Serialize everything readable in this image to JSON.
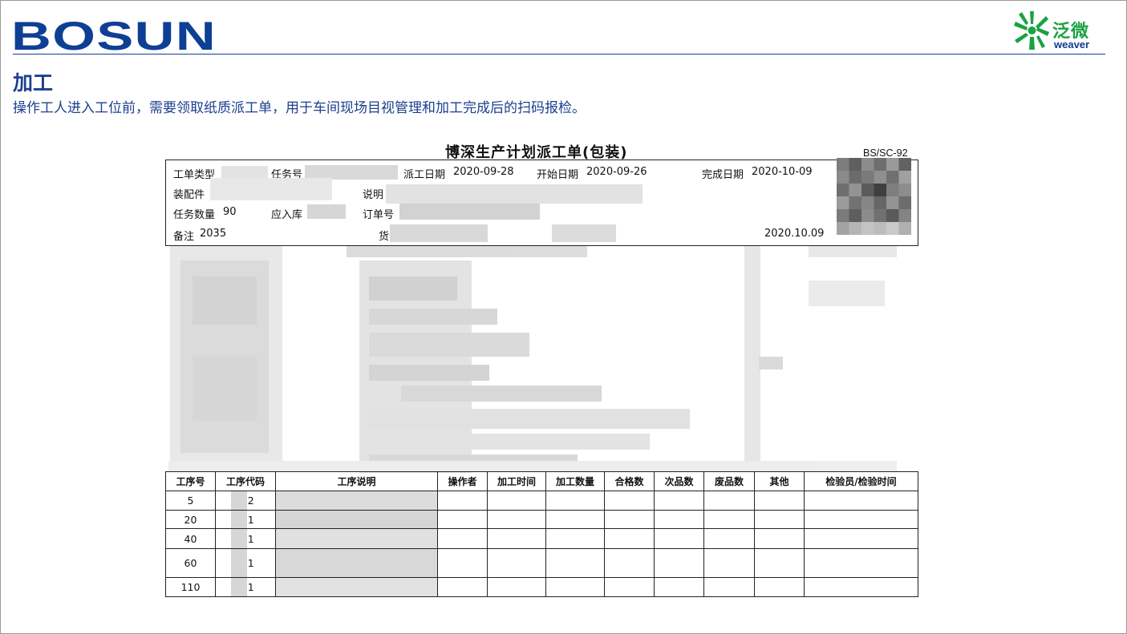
{
  "header": {
    "brand": "BOSUN",
    "partner_cn": "泛微",
    "partner_en": "weaver",
    "colors": {
      "brand_blue": "#0e3f94",
      "partner_green": "#1aa243",
      "text_blue": "#1c3f8f"
    }
  },
  "section": {
    "title": "加工",
    "description": "操作工人进入工位前，需要领取纸质派工单，用于车间现场目视管理和加工完成后的扫码报检。"
  },
  "document": {
    "title": "博深生产计划派工单(包装)",
    "code": "BS/SC-92",
    "fields": {
      "order_type_label": "工单类型",
      "task_no_label": "任务号",
      "dispatch_date_label": "派工日期",
      "dispatch_date": "2020-09-28",
      "start_date_label": "开始日期",
      "start_date": "2020-09-26",
      "finish_date_label": "完成日期",
      "finish_date": "2020-10-09",
      "part_label": "装配件",
      "note_label": "说明",
      "task_qty_label": "任务数量",
      "task_qty": "90",
      "inbound_label": "应入库",
      "order_no_label": "订单号",
      "remark_label": "备注",
      "remark": "2035",
      "item_no_label": "货号",
      "print_date": "2020.10.09"
    },
    "operations_table": {
      "headers": [
        "工序号",
        "工序代码",
        "工序说明",
        "操作者",
        "加工时间",
        "加工数量",
        "合格数",
        "次品数",
        "废品数",
        "其他",
        "检验员/检验时间"
      ],
      "rows": [
        {
          "seq": "5",
          "code": "H  2"
        },
        {
          "seq": "20",
          "code": "H  1"
        },
        {
          "seq": "40",
          "code": "H  1"
        },
        {
          "seq": "60",
          "code": "H  1"
        },
        {
          "seq": "110",
          "code": "H  1"
        }
      ]
    }
  }
}
